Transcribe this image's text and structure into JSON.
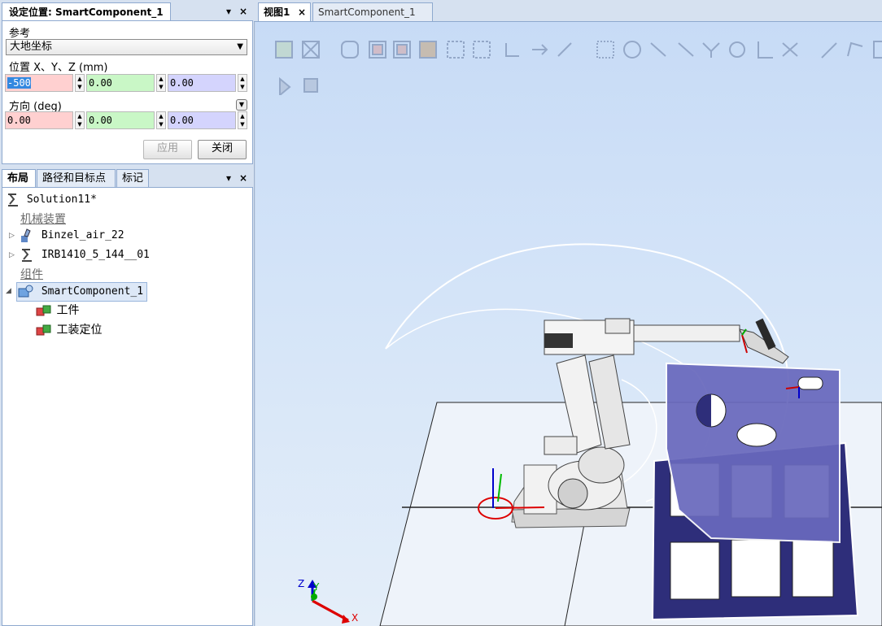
{
  "set_position": {
    "title": "设定位置: SmartComponent_1",
    "reference_label": "参考",
    "reference_value": "大地坐标",
    "position_label": "位置 X、Y、Z (mm)",
    "position": [
      "-500",
      "0.00",
      "0.00"
    ],
    "orientation_label": "方向 (deg)",
    "orientation": [
      "0.00",
      "0.00",
      "0.00"
    ],
    "apply_label": "应用",
    "close_label": "关闭",
    "panel_close": "×",
    "panel_menu": "▾"
  },
  "layout_panel": {
    "tabs": [
      "布局",
      "路径和目标点",
      "标记"
    ],
    "panel_close": "×",
    "panel_menu": "▾",
    "tree": {
      "solution": "Solution11*",
      "mechanisms_header": "机械装置",
      "mechanisms": [
        "Binzel_air_22",
        "IRB1410_5_144__01"
      ],
      "components_header": "组件",
      "component": "SmartComponent_1",
      "children": [
        "工件",
        "工装定位"
      ]
    }
  },
  "document_tabs": [
    {
      "label": "视图1",
      "close": "×",
      "active": true
    },
    {
      "label": "SmartComponent_1",
      "active": false
    }
  ],
  "viewport": {
    "axis_labels": {
      "x": "X",
      "y": "Y",
      "z": "Z"
    },
    "toolbar_icons": [
      "view-all-icon",
      "view-center-icon",
      "select-curve-icon",
      "select-surface-icon",
      "select-body-icon",
      "select-part-icon",
      "select-group-icon",
      "select-mechanism-icon",
      "select-target-icon",
      "select-path-icon",
      "select-frame-icon",
      "snap-object-icon",
      "snap-center-icon",
      "snap-midpoint-icon",
      "snap-edge-icon",
      "snap-end-icon",
      "snap-gravity-icon",
      "snap-local-origin-icon",
      "snap-grid-icon",
      "measure-distance-icon",
      "measure-angle-icon",
      "measure-diameter-icon",
      "play-icon",
      "stop-icon"
    ]
  },
  "colors": {
    "panel_bg": "#d6e1f0",
    "selection": "#3388e0",
    "x_field": "#ffd0d0",
    "y_field": "#c9f7c6",
    "z_field": "#d4d4fd",
    "fixture": "#3a3a88",
    "plate": "#6e6ec0"
  }
}
